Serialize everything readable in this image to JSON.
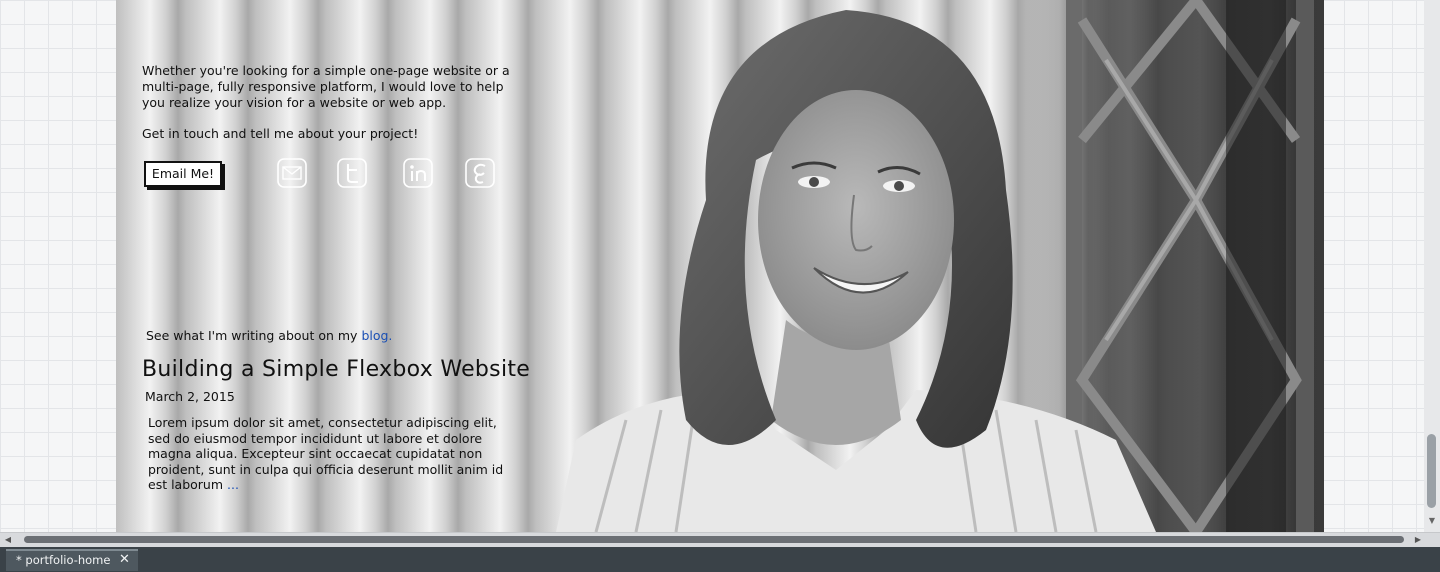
{
  "intro": {
    "paragraph1": "Whether you're looking for a simple one-page website or a multi-page, fully responsive platform, I would love to help you realize your vision for a website or web app.",
    "paragraph2": "Get in touch and tell me about your project!"
  },
  "contact": {
    "email_button_label": "Email Me!"
  },
  "social": {
    "icons": [
      "mail-icon",
      "twitter-icon",
      "linkedin-icon",
      "google-plus-icon"
    ]
  },
  "blog": {
    "intro_text": "See what I'm writing about on my",
    "link_text": "blog.",
    "post": {
      "title": "Building a Simple Flexbox Website",
      "date": "March 2, 2015",
      "excerpt": "Lorem ipsum dolor sit amet, consectetur adipiscing elit, sed do eiusmod tempor incididunt ut labore et dolore magna aliqua. Excepteur sint occaecat cupidatat non proident, sunt in culpa qui officia deserunt mollit anim id est laborum",
      "read_more": "..."
    }
  },
  "editor": {
    "tab_label": "* portfolio-home",
    "tab_close": "✕"
  }
}
